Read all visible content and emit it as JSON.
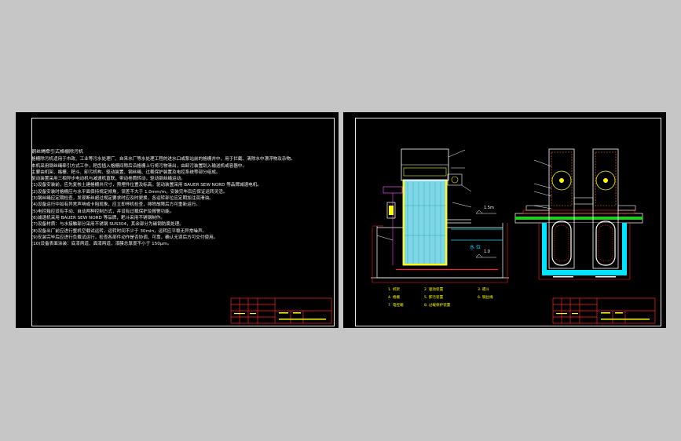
{
  "drawing": {
    "left_sheet": {
      "title": "钢丝绳牵引式格栅除污机",
      "notes": [
        "格栅除污机适用于市政、工业等污水处理厂、自来水厂等水处理工程的进水口或泵站前的格栅井中，用于拦截、清除水中漂浮物及杂物。",
        "本机采用钢丝绳牵引方式工作，耙齿插入格栅间隙后沿格栅上行将污物清出，由卸污装置刮入输送机或容器中。",
        "主要由机架、格栅、耙斗、卸污机构、驱动装置、钢丝绳、过载保护装置及电控系统等部分组成。",
        "驱动装置采用三相异步电动机与减速机直联，带动卷筒转动，驱动钢丝绳运动。",
        "(1)设备安装前，应先复核土建格栅井尺寸，预埋件位置及标高。驱动装置采用 BAUER SEW NORD 等品牌减速电机。",
        "(2)设备安装时格栅应与水平面保持规定倾角，误差不大于 1.0mm/m，安装完毕后应保证运转灵活。",
        "(3)钢丝绳应定期检查，发现断丝超过规定要求时应及时更换，各运转部位应定期加注润滑油。",
        "(4)设备运行中如有异常声响或卡阻现象，应立即停机检查，排除故障后方可重新运行。",
        "(5)电控箱应设有手动、自动两种控制方式，并设有过载保护及报警功能。",
        "(6)减速机采用 BAUER SEW NORD 等品牌，耙斗采用不锈钢制作。",
        "(7)设备材质：与水接触部分采用不锈钢 SUS304，其余部分为碳钢防腐处理。",
        "(8)设备出厂前应进行整机空载试运转，运转时间不少于 30min，运转应平稳无异常噪声。",
        "(9)安装完毕后应进行负载试运行，检查各部件动作是否协调、可靠，确认无误后方可交付使用。",
        "(10)设备表面涂装：底漆两道、面漆两道，漆膜总厚度不小于 150μm。"
      ]
    },
    "right_sheet": {
      "water_level_high": "1.5m",
      "water_level_low": "1.0",
      "water_label": "水 位",
      "legend": [
        "1. 机架",
        "2. 驱动装置",
        "3. 耙斗",
        "4. 格栅",
        "5. 卸污装置",
        "6. 钢丝绳",
        "7. 电控箱",
        "8. 过载保护装置"
      ]
    }
  },
  "colors": {
    "background": "#c6c6c6",
    "sheet": "#000000",
    "frame": "#e8e8e8",
    "grid_fill": "#7fd7e6",
    "outline": "#ffffff",
    "red": "#ff2020",
    "yellow": "#ffff00",
    "green": "#22cc22",
    "cyan": "#00e5ff",
    "magenta": "#ff40ff",
    "blue": "#3060ff"
  }
}
